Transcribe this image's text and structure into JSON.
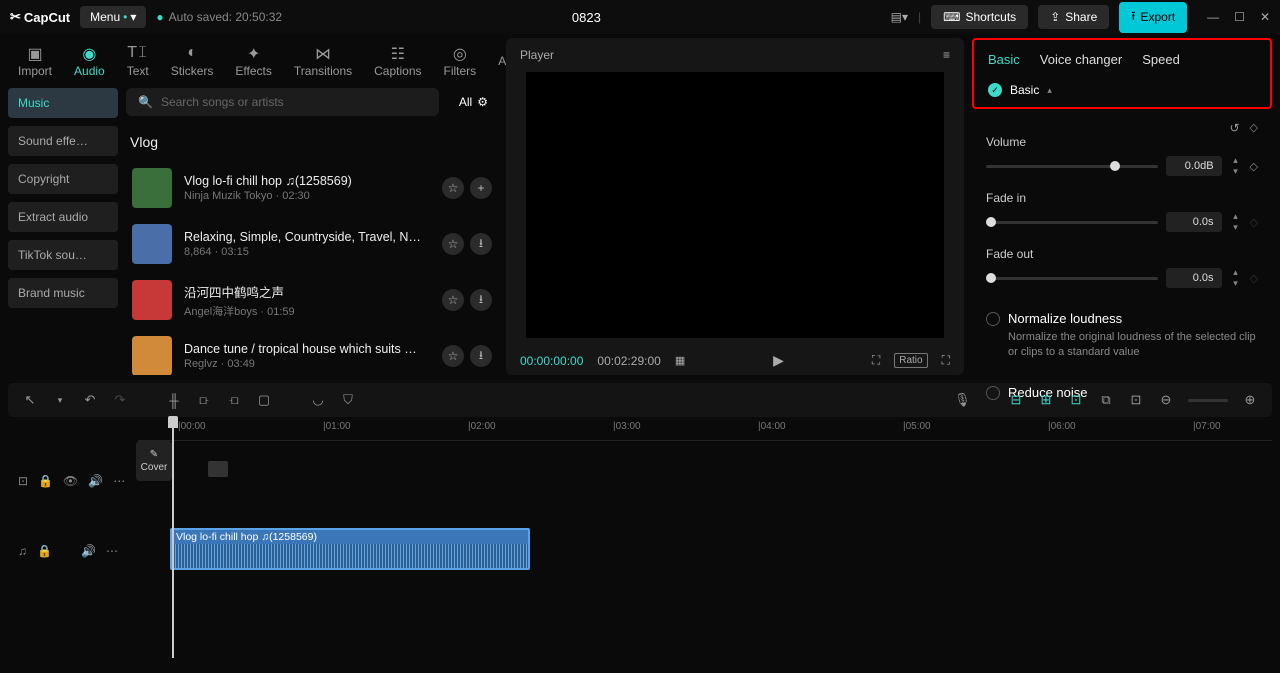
{
  "titlebar": {
    "logo": "CapCut",
    "menu": "Menu",
    "autosave": "Auto saved: 20:50:32",
    "project": "0823",
    "shortcuts": "Shortcuts",
    "share": "Share",
    "export": "Export"
  },
  "nav": {
    "import": "Import",
    "audio": "Audio",
    "text": "Text",
    "stickers": "Stickers",
    "effects": "Effects",
    "transitions": "Transitions",
    "captions": "Captions",
    "filters": "Filters",
    "a": "A"
  },
  "categories": {
    "music": "Music",
    "sound": "Sound effe…",
    "copyright": "Copyright",
    "extract": "Extract audio",
    "tiktok": "TikTok sou…",
    "brand": "Brand music"
  },
  "search": {
    "placeholder": "Search songs or artists",
    "all": "All"
  },
  "section": "Vlog",
  "songs": [
    {
      "title": "Vlog  lo-fi chill hop ♫(1258569)",
      "meta": "Ninja Muzik Tokyo · 02:30",
      "thumb": "#3a6f3c",
      "action2": "plus"
    },
    {
      "title": "Relaxing, Simple, Countryside, Travel, N…",
      "meta": "8,864 · 03:15",
      "thumb": "#4a6fa8",
      "action2": "download"
    },
    {
      "title": "沿河四中鹤鸣之声",
      "meta": "Angel海洋boys · 01:59",
      "thumb": "#c73838",
      "action2": "download"
    },
    {
      "title": "Dance tune / tropical house which suits …",
      "meta": "Reglvz · 03:49",
      "thumb": "#d08a3a",
      "action2": "download"
    }
  ],
  "player": {
    "title": "Player",
    "cur": "00:00:00:00",
    "dur": "00:02:29:00",
    "ratio": "Ratio"
  },
  "inspector": {
    "tabs": {
      "basic": "Basic",
      "voice": "Voice changer",
      "speed": "Speed"
    },
    "basicLabel": "Basic",
    "volume": {
      "label": "Volume",
      "value": "0.0dB"
    },
    "fadein": {
      "label": "Fade in",
      "value": "0.0s"
    },
    "fadeout": {
      "label": "Fade out",
      "value": "0.0s"
    },
    "normalize": {
      "title": "Normalize loudness",
      "desc": "Normalize the original loudness of the selected clip or clips to a standard value"
    },
    "reduce": "Reduce noise"
  },
  "ruler": [
    "00:00",
    "01:00",
    "02:00",
    "03:00",
    "04:00",
    "05:00",
    "06:00",
    "07:00"
  ],
  "cover": "Cover",
  "clip": "Vlog  lo-fi chill hop ♫(1258569)"
}
